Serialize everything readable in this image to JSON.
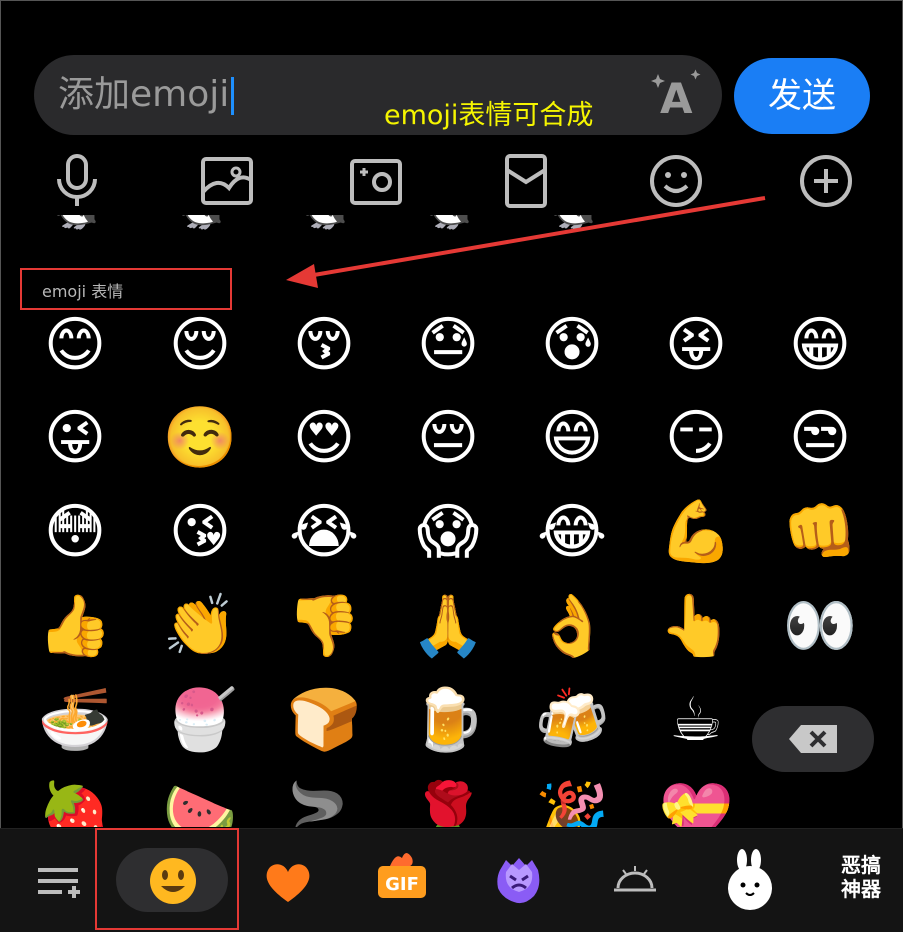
{
  "input": {
    "value": "添加emoji"
  },
  "send_label": "发送",
  "annotation": "emoji表情可合成",
  "section_label": "emoji 表情",
  "toolbar": [
    "microphone-icon",
    "image-icon",
    "camera-icon",
    "red-packet-icon",
    "smiley-icon",
    "plus-icon"
  ],
  "peek_row": [
    "🐧",
    "🐧",
    "🐧",
    "🐧",
    "🐧"
  ],
  "emoji_rows": [
    [
      "😊",
      "😌",
      "😚",
      "😓",
      "😰",
      "😝",
      "😁"
    ],
    [
      "😜",
      "☺️",
      "😍",
      "😔",
      "😄",
      "😏",
      "😒"
    ],
    [
      "😳",
      "😘",
      "😭",
      "😱",
      "😂",
      "💪",
      "👊"
    ],
    [
      "👍",
      "👏",
      "👎",
      "🙏",
      "👌",
      "👆",
      "👀"
    ],
    [
      "🍜",
      "🍧",
      "🍞",
      "🍺",
      "🍻",
      "☕",
      ""
    ],
    [
      "🍓",
      "🍉",
      "🚬",
      "🌹",
      "🎉",
      "💝",
      ""
    ]
  ],
  "categories": [
    "add-list-icon",
    "smiley-face-icon",
    "heart-icon",
    "gif-icon",
    "blob-face-icon",
    "serving-dome-icon",
    "bunny-sticker-icon"
  ],
  "sticker_label": "恶搞神器",
  "colors": {
    "send": "#1a7ef5",
    "annotation": "#f5f500",
    "highlight": "#e53935",
    "caret": "#1e90ff"
  }
}
